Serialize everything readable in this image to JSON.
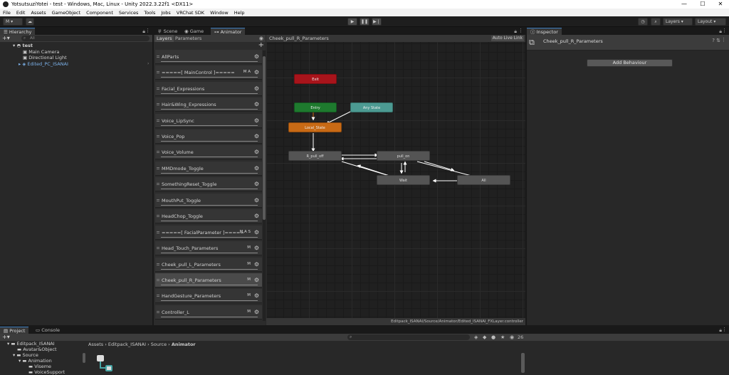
{
  "window": {
    "title": "YotsutsuziYotei - test - Windows, Mac, Linux - Unity 2022.3.22f1 <DX11>",
    "min": "—",
    "max": "☐",
    "close": "✕"
  },
  "menu": [
    "File",
    "Edit",
    "Assets",
    "GameObject",
    "Component",
    "Services",
    "Tools",
    "Jobs",
    "VRChat SDK",
    "Window",
    "Help"
  ],
  "toolbar": {
    "account": "M",
    "layers": "Layers",
    "layout": "Layout"
  },
  "hierarchy": {
    "tab": "Hierarchy",
    "search_placeholder": "All",
    "scene": "test",
    "items": [
      "Main Camera",
      "Directional Light",
      "Edited_PC_ISANAI"
    ]
  },
  "center_tabs": [
    "Scene",
    "Game",
    "Animator"
  ],
  "animator": {
    "subtabs": [
      "Layers",
      "Parameters"
    ],
    "breadcrumb": "Cheek_pull_R_Parameters",
    "auto_live_link": "Auto Live Link",
    "layers": [
      {
        "name": "AllParts",
        "flags": ""
      },
      {
        "name": "=====[ MainControl ]=====",
        "flags": "M A"
      },
      {
        "name": "Facial_Expressions",
        "flags": ""
      },
      {
        "name": "Hair&Wing_Expressions",
        "flags": ""
      },
      {
        "name": "Voice_LipSync",
        "flags": ""
      },
      {
        "name": "Voice_Pop",
        "flags": ""
      },
      {
        "name": "Voice_Volume",
        "flags": ""
      },
      {
        "name": "MMDmode_Toggle",
        "flags": ""
      },
      {
        "name": "SomethingReset_Toggle",
        "flags": ""
      },
      {
        "name": "MouthPut_Toggle",
        "flags": ""
      },
      {
        "name": "HeadChop_Toggle",
        "flags": ""
      },
      {
        "name": "=====[ FacialParameter ]=====",
        "flags": "M A S"
      },
      {
        "name": "Head_Touch_Parameters",
        "flags": "M"
      },
      {
        "name": "Cheek_pull_L_Parameters",
        "flags": "M"
      },
      {
        "name": "Cheek_pull_R_Parameters",
        "flags": "M"
      },
      {
        "name": "HandGesture_Parameters",
        "flags": "M"
      },
      {
        "name": "Controller_L",
        "flags": "M"
      }
    ],
    "nodes": {
      "exit": "Exit",
      "entry": "Entry",
      "any_state": "Any State",
      "local_state": "Local_State",
      "r_pull_off": "R_pull_off",
      "pull_on": "pull_on",
      "wait": "Wait",
      "all": "All"
    },
    "status_path": "Editpack_ISANAI/Source/Animator/Edited_ISANAI_FXLayer.controller"
  },
  "inspector": {
    "tab": "Inspector",
    "object": "Cheek_pull_R_Parameters",
    "add_behaviour": "Add Behaviour"
  },
  "bottom": {
    "tabs": [
      "Project",
      "Console"
    ],
    "tree": [
      "Editpack_ISANAI",
      "Avatar&Object",
      "Source",
      "Animation",
      "Viseme",
      "VoiceSupport"
    ],
    "breadcrumb": [
      "Assets",
      "Editpack_ISANAI",
      "Source",
      "Animator"
    ],
    "count": "26"
  },
  "colors": {
    "exit": "#a8141b",
    "entry": "#1e7a2e",
    "any_state": "#4c9a92",
    "default_state": "#c86a15",
    "selected_tab_accent": "#3a79bb"
  }
}
